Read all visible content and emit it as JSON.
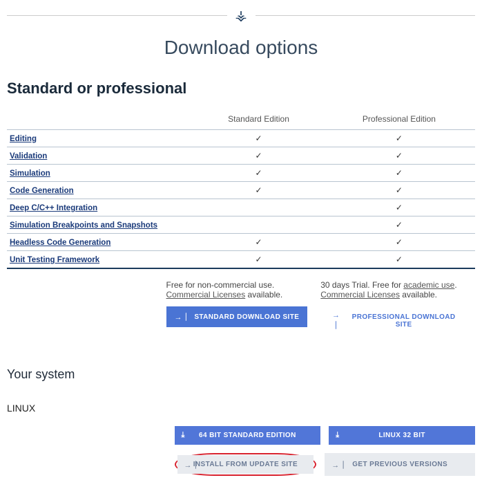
{
  "page_title": "Download options",
  "section1_heading": "Standard or professional",
  "columns": {
    "standard": "Standard Edition",
    "professional": "Professional Edition"
  },
  "features": [
    {
      "label": "Editing",
      "std": true,
      "pro": true
    },
    {
      "label": "Validation",
      "std": true,
      "pro": true
    },
    {
      "label": "Simulation",
      "std": true,
      "pro": true
    },
    {
      "label": "Code Generation",
      "std": true,
      "pro": true
    },
    {
      "label": "Deep C/C++ Integration",
      "std": false,
      "pro": true
    },
    {
      "label": "Simulation Breakpoints and Snapshots",
      "std": false,
      "pro": true
    },
    {
      "label": "Headless Code Generation",
      "std": true,
      "pro": true
    },
    {
      "label": "Unit Testing Framework",
      "std": true,
      "pro": true
    }
  ],
  "desc": {
    "std_prefix": "Free for non-commercial use. ",
    "std_link": "Commercial Licenses",
    "std_suffix": " available.",
    "pro_prefix": "30 days Trial. Free for ",
    "pro_link1": "academic use",
    "pro_mid": ". ",
    "pro_link2": "Commercial Licenses",
    "pro_suffix": " available."
  },
  "buttons": {
    "std_download": "STANDARD DOWNLOAD SITE",
    "pro_download": "PROFESSIONAL DOWNLOAD SITE"
  },
  "section2_heading": "Your system",
  "os_label": "LINUX",
  "dl_buttons": {
    "b1": "64 BIT STANDARD EDITION",
    "b2": "LINUX 32 BIT",
    "b3": "INSTALL FROM UPDATE SITE",
    "b4": "GET PREVIOUS VERSIONS"
  }
}
